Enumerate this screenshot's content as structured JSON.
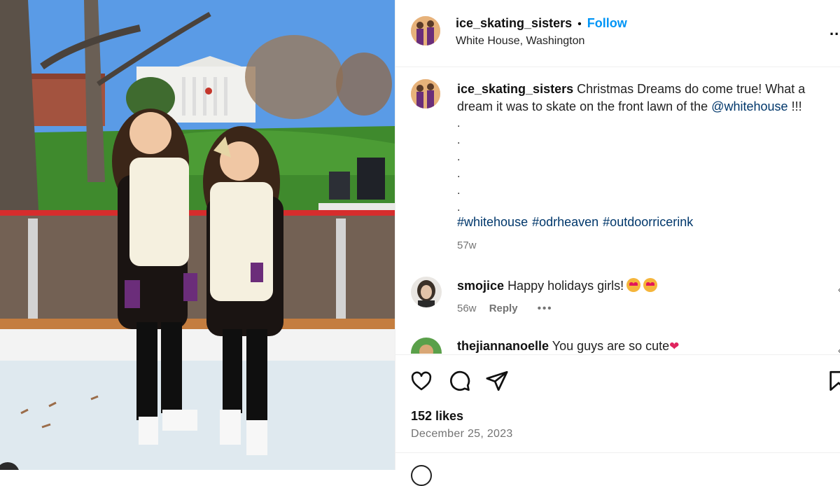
{
  "post": {
    "username": "ice_skating_sisters",
    "separator": "•",
    "follow_label": "Follow",
    "location": "White House, Washington",
    "more_label": "...",
    "caption_text": "Christmas Dreams do come true! What a dream it was to skate on the front lawn of the",
    "caption_mention": "@whitehouse",
    "caption_end": " !!!",
    "caption_dots": [
      ".",
      ".",
      ".",
      ".",
      ".",
      "."
    ],
    "hashtags": [
      "#whitehouse",
      "#odrheaven",
      "#outdoorricerink"
    ],
    "caption_age": "57w",
    "likes": "152 likes",
    "date": "December 25, 2023"
  },
  "comments": [
    {
      "username": "smojice",
      "text": "Happy holidays girls!",
      "age": "56w",
      "reply_label": "Reply",
      "options_label": "•••"
    },
    {
      "username": "thejiannanoelle",
      "text": "You guys are so cute"
    }
  ],
  "icons": {
    "like": "heart-icon",
    "comment": "comment-icon",
    "share": "share-icon",
    "save": "bookmark-icon"
  },
  "colors": {
    "link": "#0095f6",
    "mention": "#00376b",
    "meta": "#737373"
  }
}
